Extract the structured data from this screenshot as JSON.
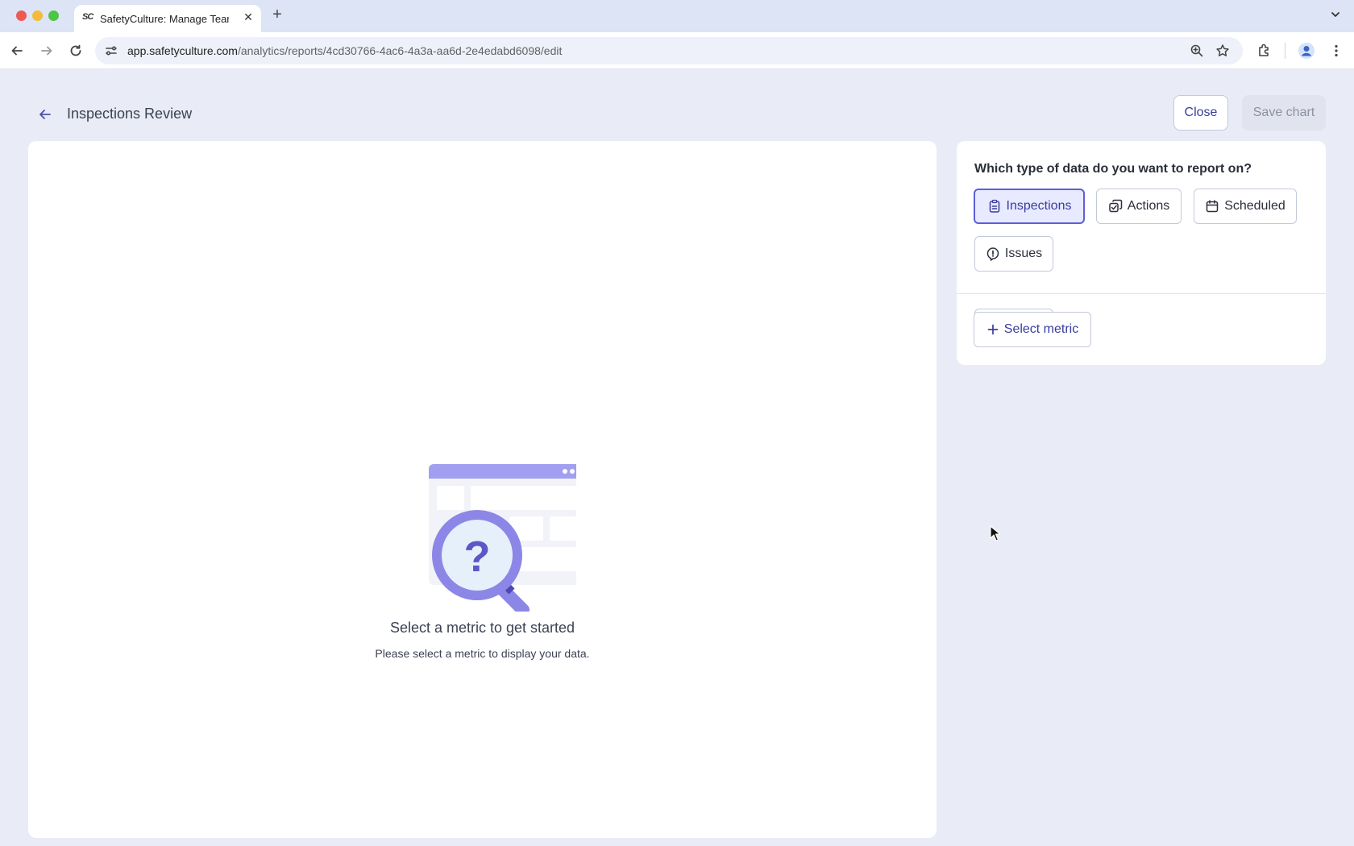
{
  "browser": {
    "tab_title": "SafetyCulture: Manage Teams",
    "tab_favicon": "SC",
    "new_tab": "+",
    "tab_close": "✕",
    "url_host": "app.safetyculture.com",
    "url_path": "/analytics/reports/4cd30766-4ac6-4a3a-aa6d-2e4edabd6098/edit",
    "icons": [
      "back-icon",
      "forward-icon",
      "reload-icon",
      "site-settings-icon",
      "zoom-icon",
      "bookmark-star-icon",
      "extensions-icon",
      "profile-icon",
      "menu-kebab-icon",
      "tab-list-icon"
    ]
  },
  "header": {
    "title": "Inspections Review",
    "close_label": "Close",
    "save_label": "Save chart"
  },
  "empty_state": {
    "title": "Select a metric to get started",
    "subtitle": "Please select a metric to display your data."
  },
  "data_panel": {
    "question": "Which type of data do you want to report on?",
    "types": [
      {
        "label": "Inspections",
        "icon": "clipboard-icon",
        "selected": true
      },
      {
        "label": "Actions",
        "icon": "actions-icon",
        "selected": false
      },
      {
        "label": "Scheduled",
        "icon": "calendar-icon",
        "selected": false
      },
      {
        "label": "Issues",
        "icon": "issue-alert-icon",
        "selected": false
      }
    ],
    "metric_button": "Select metric"
  },
  "colors": {
    "accent": "#5c5fd6",
    "accent_text": "#3a3c9c",
    "page_bg": "#e9ecf7",
    "illustration_purple": "#8c87e6"
  }
}
